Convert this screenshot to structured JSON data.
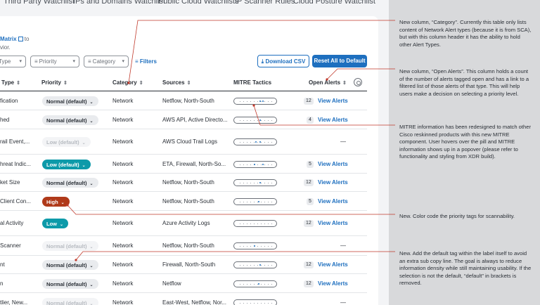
{
  "tabs": [
    "Third Party Watchlist",
    "IPs and Domains Watchlist",
    "Public Cloud Watchlists",
    "IP Scanner Rules",
    "Cloud Posture Watchlist"
  ],
  "intro": {
    "link": "Matrix",
    "line1_suffix": " to",
    "line2": "vior."
  },
  "filters": {
    "type": "Type",
    "priority": "Priority",
    "category": "Category",
    "filters_link": "Filters"
  },
  "actions": {
    "download": "Download CSV",
    "reset": "Reset All to Default"
  },
  "columns": {
    "type": "Type",
    "priority": "Priority",
    "category": "Category",
    "sources": "Sources",
    "mitre": "MITRE Tactics",
    "open_alerts": "Open Alerts"
  },
  "rows": [
    {
      "type": "fication",
      "priority": "Normal (default)",
      "ptype": "default",
      "category": "Network",
      "sources": "Netflow, North-South",
      "count": "12",
      "link": "View Alerts"
    },
    {
      "type": "hed",
      "priority": "Normal (default)",
      "ptype": "default",
      "category": "Network",
      "sources": "AWS API, Active Directo...",
      "count": "4",
      "link": "View Alerts"
    },
    {
      "type": "rail Event,...",
      "priority": "Low (default)",
      "ptype": "muted",
      "category": "Network",
      "sources": "AWS Cloud Trail Logs",
      "count": "",
      "link": "",
      "dash": "—"
    },
    {
      "type": "hreat Indic...",
      "priority": "Low (default)",
      "ptype": "low",
      "category": "Network",
      "sources": "ETA, Firewall, North-So...",
      "count": "5",
      "link": "View Alerts"
    },
    {
      "type": "ket Size",
      "priority": "Normal (default)",
      "ptype": "default",
      "category": "Network",
      "sources": "Netflow, North-South",
      "count": "12",
      "link": "View Alerts"
    },
    {
      "type": "Client Con...",
      "priority": "High",
      "ptype": "high",
      "category": "Network",
      "sources": "Netflow, North-South",
      "count": "5",
      "link": "View Alerts"
    },
    {
      "type": "al Activity",
      "priority": "Low",
      "ptype": "low",
      "category": "Network",
      "sources": "Azure Activity Logs",
      "count": "12",
      "link": "View Alerts"
    },
    {
      "type": "Scanner",
      "priority": "Normal (default)",
      "ptype": "muted",
      "category": "Network",
      "sources": "Netflow, North-South",
      "count": "",
      "link": "",
      "dash": "—"
    },
    {
      "type": "nt",
      "priority": "Normal (default)",
      "ptype": "default",
      "category": "Network",
      "sources": "Firewall, North-South",
      "count": "12",
      "link": "View Alerts"
    },
    {
      "type": "n",
      "priority": "Normal (default)",
      "ptype": "default",
      "category": "Network",
      "sources": "Netflow",
      "count": "12",
      "link": "View Alerts"
    },
    {
      "type": "tlier, New...",
      "priority": "Normal (default)",
      "ptype": "muted",
      "category": "Network",
      "sources": "East-West, Netflow, Nor...",
      "count": "",
      "link": "",
      "dash": "—"
    }
  ],
  "notes": [
    "New column, “Category”. Currently this table only lists content of Network Alert types (because it is from SCA), but with this column header it has the ability to hold other Alert Types.",
    "New column, “Open Alerts”. This column holds a count of the number of alerts tagged open and has a link to a filtered list of those alerts of that type. This will help users make a decision on selecting a priority level.",
    "MITRE information has been redesigned to match other Cisco reskinned products with this new MITRE component. User hovers over the pill and MITRE information shows up in a popover (please refer to functionality and styling from XDR build).",
    "New. Color code the priority tags for scannability.",
    "New. Add the default tag within the label itself to avoid an extra sub copy line. The goal is always to reduce information density while still maintaining usability. If the selection is not the default, “default” in brackets is removed."
  ],
  "colors": {
    "accent": "#1e6fbf",
    "low": "#0d9aa9",
    "high": "#b03a1a",
    "annotation_line": "#c0392b"
  }
}
